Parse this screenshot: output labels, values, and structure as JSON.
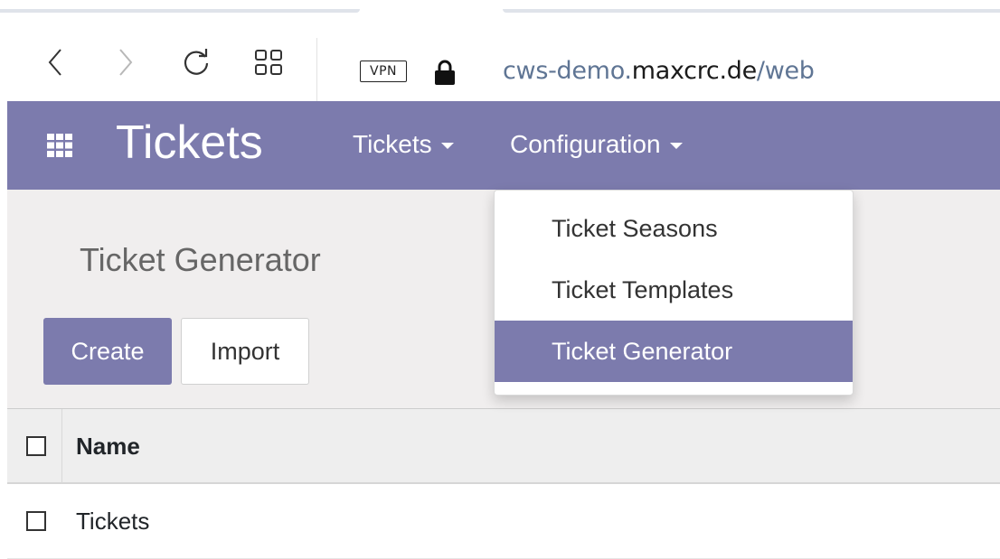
{
  "browser": {
    "vpn_label": "VPN",
    "url": {
      "prefix": "cws-demo.",
      "host": "maxcrc.de",
      "path": "/web"
    }
  },
  "navbar": {
    "brand": "Tickets",
    "menus": [
      {
        "label": "Tickets"
      },
      {
        "label": "Configuration"
      }
    ]
  },
  "dropdown": {
    "items": [
      {
        "label": "Ticket Seasons",
        "active": false
      },
      {
        "label": "Ticket Templates",
        "active": false
      },
      {
        "label": "Ticket Generator",
        "active": true
      }
    ]
  },
  "control_panel": {
    "title": "Ticket Generator",
    "create_label": "Create",
    "import_label": "Import"
  },
  "list": {
    "columns": [
      "Name"
    ],
    "rows": [
      {
        "name": "Tickets"
      }
    ]
  },
  "colors": {
    "brand": "#7c7bad",
    "control_panel_bg": "#f0eeee"
  },
  "icons": [
    "back-icon",
    "forward-icon",
    "reload-icon",
    "grid-icon",
    "lock-icon",
    "apps-icon",
    "caret-down-icon"
  ]
}
